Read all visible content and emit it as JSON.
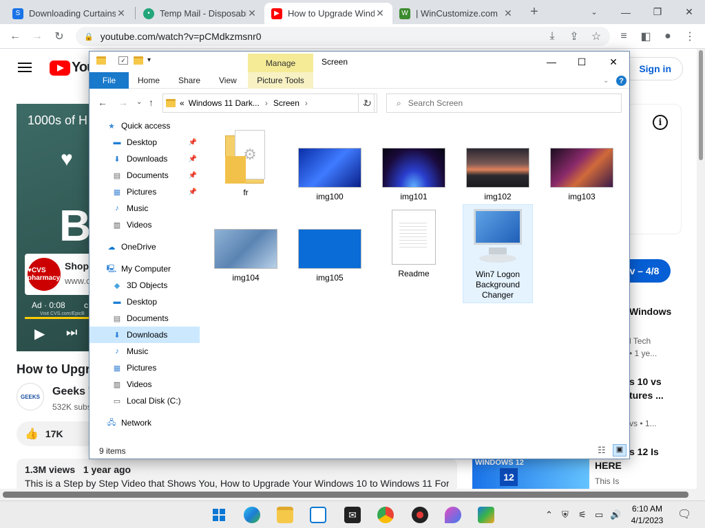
{
  "browser": {
    "tabs": [
      {
        "title": "Downloading Curtains",
        "active": false,
        "color": "#1a73e8"
      },
      {
        "title": "Temp Mail - Disposable",
        "active": false,
        "color": "#22a67a"
      },
      {
        "title": "How to Upgrade Windo",
        "active": true,
        "color": "#ff0000"
      },
      {
        "title": "| WinCustomize.com",
        "active": false,
        "color": "#3c8a2e"
      }
    ],
    "new_tab": "+",
    "url": "youtube.com/watch?v=pCMdkzmsnr0"
  },
  "youtube": {
    "logo_text": "You",
    "sign_in": "Sign in",
    "video_overlay_title": "1000s of H",
    "video_big_letter": "B",
    "ad_shop": "Shop",
    "ad_www": "www.c",
    "ad_timer": "Ad · 0:08",
    "ad_c": "c",
    "cvs_logo": "♥CVS pharmacy",
    "ad_url": "Visit CVS.com/EpicB",
    "progress": 0.27,
    "video_title": "How to Upgr",
    "channel_name": "Geeks T",
    "channel_subs": "532K subs",
    "channel_logo": "GEEKS",
    "likes": "17K",
    "views": "1.3M views",
    "age": "1 year ago",
    "description": "This is a Step by Step Video that Shows You, How to Upgrade Your Windows 10 to Windows 11 For",
    "pill": "v – 4/8",
    "recs": [
      {
        "title": "Windows",
        "sub1": "l Tech",
        "sub2": "• 1 ye..."
      },
      {
        "title": "s 10 vs",
        "title2": "tures ...",
        "sub1": "vs • 1..."
      },
      {
        "title": "s 12 Is",
        "title2": "HERE",
        "sub1": "This Is"
      }
    ],
    "thumb_title": "WINDOWS 12",
    "thumb_num": "12"
  },
  "explorer": {
    "manage": "Manage",
    "context_title": "Screen",
    "ribbon_tabs": [
      "File",
      "Home",
      "Share",
      "View",
      "Picture Tools"
    ],
    "breadcrumb": [
      "«",
      "Windows 11 Dark...",
      "Screen"
    ],
    "search_placeholder": "Search Screen",
    "nav": [
      {
        "label": "Quick access",
        "icon": "star-icon",
        "indent": 0,
        "pinned": false,
        "selected": false
      },
      {
        "label": "Desktop",
        "icon": "desktop-icon",
        "indent": 1,
        "pinned": true,
        "selected": false
      },
      {
        "label": "Downloads",
        "icon": "download-icon",
        "indent": 1,
        "pinned": true,
        "selected": false
      },
      {
        "label": "Documents",
        "icon": "document-icon",
        "indent": 1,
        "pinned": true,
        "selected": false
      },
      {
        "label": "Pictures",
        "icon": "pictures-icon",
        "indent": 1,
        "pinned": true,
        "selected": false
      },
      {
        "label": "Music",
        "icon": "music-icon",
        "indent": 1,
        "pinned": false,
        "selected": false
      },
      {
        "label": "Videos",
        "icon": "video-icon",
        "indent": 1,
        "pinned": false,
        "selected": false
      },
      {
        "label": "OneDrive",
        "icon": "cloud-icon",
        "indent": 0,
        "pinned": false,
        "selected": false
      },
      {
        "label": "My Computer",
        "icon": "computer-icon",
        "indent": 0,
        "pinned": false,
        "selected": false
      },
      {
        "label": "3D Objects",
        "icon": "cube-icon",
        "indent": 1,
        "pinned": false,
        "selected": false
      },
      {
        "label": "Desktop",
        "icon": "desktop-icon",
        "indent": 1,
        "pinned": false,
        "selected": false
      },
      {
        "label": "Documents",
        "icon": "document-icon",
        "indent": 1,
        "pinned": false,
        "selected": false
      },
      {
        "label": "Downloads",
        "icon": "download-icon",
        "indent": 1,
        "pinned": false,
        "selected": true
      },
      {
        "label": "Music",
        "icon": "music-icon",
        "indent": 1,
        "pinned": false,
        "selected": false
      },
      {
        "label": "Pictures",
        "icon": "pictures-icon",
        "indent": 1,
        "pinned": false,
        "selected": false
      },
      {
        "label": "Videos",
        "icon": "video-icon",
        "indent": 1,
        "pinned": false,
        "selected": false
      },
      {
        "label": "Local Disk (C:)",
        "icon": "drive-icon",
        "indent": 1,
        "pinned": false,
        "selected": false
      },
      {
        "label": "Network",
        "icon": "network-icon",
        "indent": 0,
        "pinned": false,
        "selected": false
      }
    ],
    "files": [
      {
        "name": "fr",
        "kind": "folder"
      },
      {
        "name": "img100",
        "kind": "image",
        "bg": "linear-gradient(135deg,#0a2fa8,#3f7bff 50%,#0a1f88)"
      },
      {
        "name": "img101",
        "kind": "image",
        "bg": "radial-gradient(ellipse at 50% 100%,#5fb2ff 0%,#2a3fcf 30%,#1a0a3a 70%,#050510 100%)"
      },
      {
        "name": "img102",
        "kind": "image",
        "bg": "linear-gradient(180deg,#2b2630 0%,#7a5a55 40%,#e0825a 55%,#2c2a2e 70%,#1a1a1e 100%)"
      },
      {
        "name": "img103",
        "kind": "image",
        "bg": "linear-gradient(135deg,#1a0d20 0%,#8a2a6a 40%,#d06a3a 60%,#3a1a4a 100%)"
      },
      {
        "name": "img104",
        "kind": "image",
        "bg": "linear-gradient(135deg,#8fb3d6 0%,#5b84b3 50%,#b9d1e8 100%)"
      },
      {
        "name": "img105",
        "kind": "image",
        "bg": "#0a6cd6"
      },
      {
        "name": "Readme",
        "kind": "text"
      },
      {
        "name": "Win7 Logon Background Changer",
        "kind": "app"
      }
    ],
    "status": "9 items"
  },
  "taskbar": {
    "time": "6:10 AM",
    "date": "4/1/2023"
  }
}
